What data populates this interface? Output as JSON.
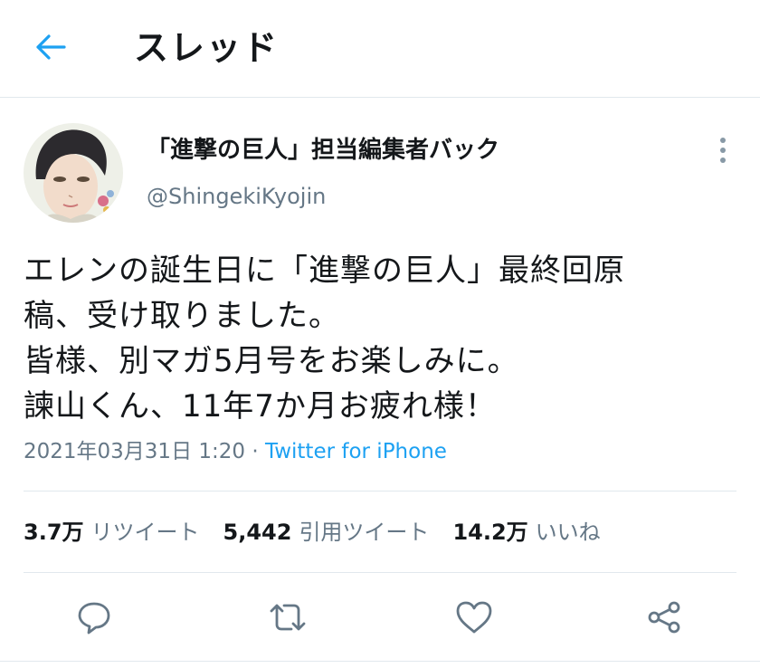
{
  "header": {
    "title": "スレッド",
    "back_icon": "arrow-left-icon",
    "accent_color": "#1da1f2"
  },
  "tweet": {
    "display_name": "「進撃の巨人」担当編集者バック",
    "handle": "@ShingekiKyojin",
    "avatar_icon": "user-avatar",
    "more_icon": "more-vertical-icon",
    "text_lines": [
      "エレンの誕生日に「進撃の巨人」最終回原",
      "稿、受け取りました。",
      "皆様、別マガ5月号をお楽しみに。",
      "諫山くん、11年7か月お疲れ様！"
    ],
    "timestamp": "2021年03月31日 1:20",
    "separator": " · ",
    "source": "Twitter for iPhone"
  },
  "stats": {
    "retweets": {
      "count": "3.7万",
      "label": "リツイート"
    },
    "quotes": {
      "count": "5,442",
      "label": "引用ツイート"
    },
    "likes": {
      "count": "14.2万",
      "label": "いいね"
    }
  },
  "actions": {
    "reply_icon": "reply-icon",
    "retweet_icon": "retweet-icon",
    "like_icon": "heart-icon",
    "share_icon": "share-icon"
  }
}
